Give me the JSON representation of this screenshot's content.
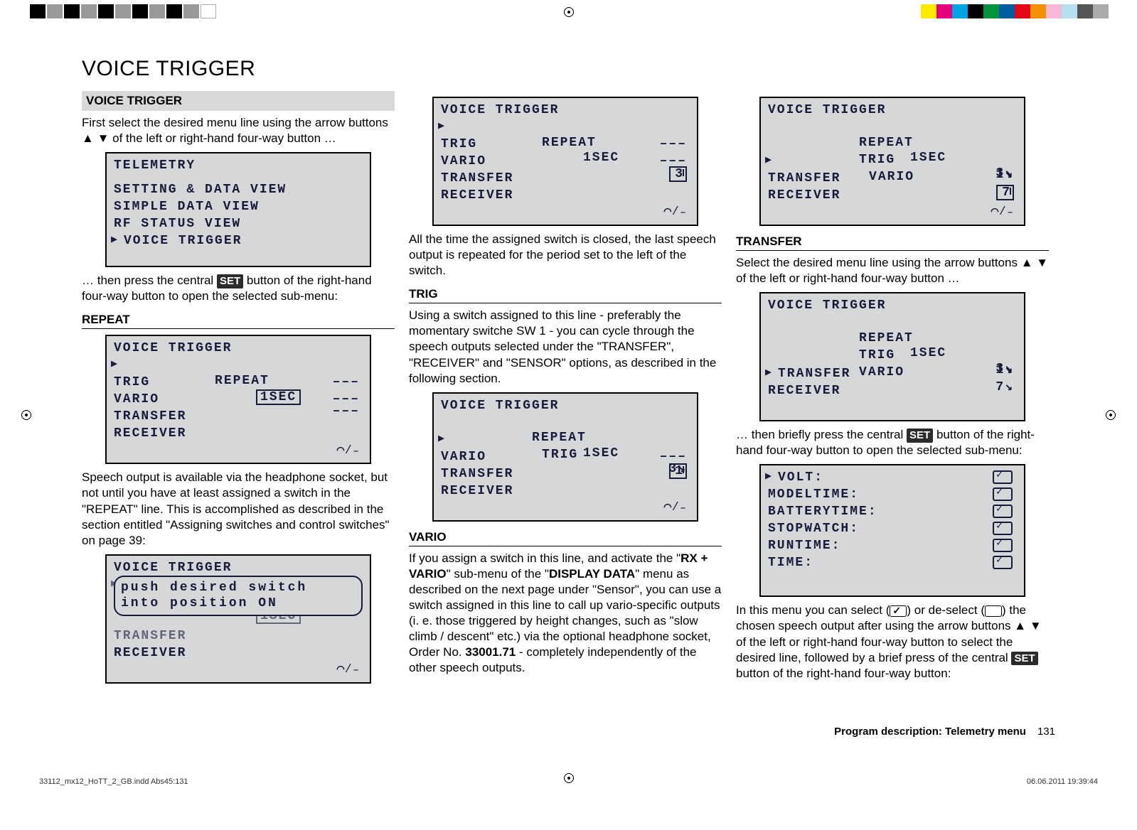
{
  "page": {
    "title": "VOICE TRIGGER",
    "footer_title": "Program description: Telemetry menu",
    "page_number": "131",
    "file_name": "33112_mx12_HoTT_2_GB.indd   Abs45:131",
    "file_date": "06.06.2011   19:39:44"
  },
  "arrows": {
    "up": "▲",
    "down": "▼"
  },
  "set_label": "SET",
  "col1": {
    "heading": "VOICE TRIGGER",
    "p1a": "First select the desired menu line using the arrow buttons ",
    "p1b": " of the left or right-hand four-way button …",
    "p2a": "… then press the central ",
    "p2b": " button of the right-hand four-way button to open the selected sub-menu:",
    "repeat_head": "REPEAT",
    "p3": "Speech output is available via the headphone socket, but not until you have at least assigned a switch in the \"REPEAT\" line. This is accomplished as described in the section entitled \"Assigning switches and control switches\" on page 39:"
  },
  "col2": {
    "p1": "All the time the assigned switch is closed, the last speech output is repeated for the period set to the left of the switch.",
    "trig_head": "TRIG",
    "p2": "Using a switch assigned to this line - preferably the momentary switche SW 1 - you can cycle through the speech outputs selected under the \"TRANSFER\", \"RECEIVER\" and \"SENSOR\" options, as described in the following section.",
    "vario_head": "VARIO",
    "p3a": "If you assign a switch in this line, and activate the \"",
    "p3b": "RX + VARIO",
    "p3c": "\" sub-menu of the \"",
    "p3d": "DISPLAY DATA",
    "p3e": "\" menu as described on the next page under \"Sensor\", you can use a switch assigned in this line to call up vario-specific outputs (i. e. those triggered by height changes, such as \"slow climb / descent\" etc.) via the optional headphone socket, Order No. ",
    "p3f": "33001.71",
    "p3g": " - completely independently of the other speech outputs."
  },
  "col3": {
    "transfer_head": "TRANSFER",
    "p1a": "Select the desired menu line using the arrow buttons ",
    "p1b": " of the left or right-hand four-way button …",
    "p2a": "… then briefly press the central ",
    "p2b": " button of the right-hand four-way button to open the selected sub-menu:",
    "p3a": "In this menu you can select (",
    "p3b": ") or de-select (",
    "p3c": ") the chosen speech output after using the arrow buttons ",
    "p3d": " of the left or right-hand four-way button to select the desired line, followed by a brief press of the central ",
    "p3e": " button of the right-hand four-way button:"
  },
  "lcd": {
    "title_voice": "VOICE TRIGGER",
    "title_tel": "TELEMETRY",
    "repeat": "REPEAT",
    "trig": "TRIG",
    "vario": "VARIO",
    "transfer": "TRANSFER",
    "receiver": "RECEIVER",
    "onesec": "1SEC",
    "dashes": "–––",
    "sw3": "3",
    "sw1": "1",
    "sw7": "7",
    "tel_lines": {
      "l1": "SETTING & DATA VIEW",
      "l2": "SIMPLE DATA VIEW",
      "l3": "RF STATUS VIEW",
      "l4": "VOICE TRIGGER"
    },
    "popup_l1": "push  desired  switch",
    "popup_l2": "into  position  ON",
    "volt": "VOLT:",
    "modeltime": "MODELTIME:",
    "batterytime": "BATTERYTIME:",
    "stopwatch": "STOPWATCH:",
    "runtime": "RUNTIME:",
    "time": "TIME:",
    "foot_icon": "⌒⁄₋"
  }
}
